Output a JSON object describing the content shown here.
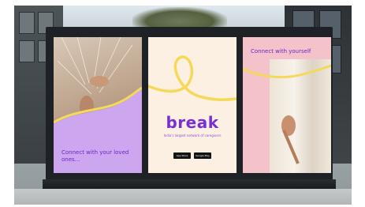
{
  "billboard": {
    "left_panel": {
      "tagline": "Connect with your loved ones..."
    },
    "middle_panel": {
      "brand": "break",
      "subtitle": "India's largest network of caregivers",
      "app_store_badge": "App Store",
      "google_play_badge": "Google Play"
    },
    "right_panel": {
      "tagline": "Connect with yourself"
    }
  },
  "colors": {
    "brand_purple": "#7a2fd6",
    "lavender": "#cda6f0",
    "cream": "#fbf0e1",
    "pink": "#f3c2cb",
    "ribbon_yellow": "#f5d95a"
  }
}
